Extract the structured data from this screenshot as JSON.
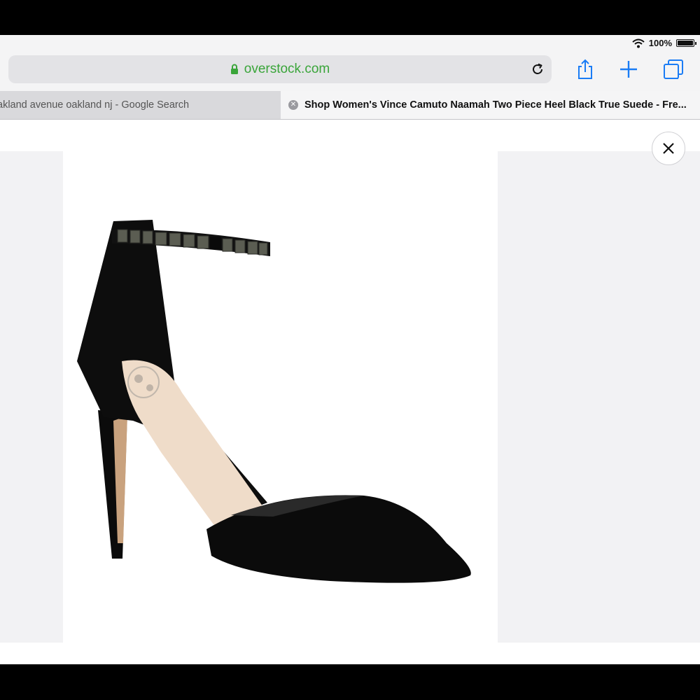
{
  "status_bar": {
    "battery_percent": "100%",
    "icons": [
      "wifi-icon",
      "battery-icon"
    ]
  },
  "toolbar": {
    "url": "overstock.com",
    "secure": true,
    "icons": [
      "lock-icon",
      "reload-icon",
      "share-icon",
      "new-tab-plus-icon",
      "tabs-overview-icon"
    ],
    "accent_color": "#1a7cf5",
    "secure_color": "#3aa53a"
  },
  "tabs": [
    {
      "title": "akland avenue oakland nj - Google Search",
      "active": false
    },
    {
      "title": "Shop Women's Vince Camuto Naamah Two Piece Heel Black True Suede - Fre...",
      "active": true
    }
  ],
  "viewer": {
    "close_icon": "close-icon",
    "product_image": "black suede pointed-toe pump with jeweled ankle strap"
  }
}
